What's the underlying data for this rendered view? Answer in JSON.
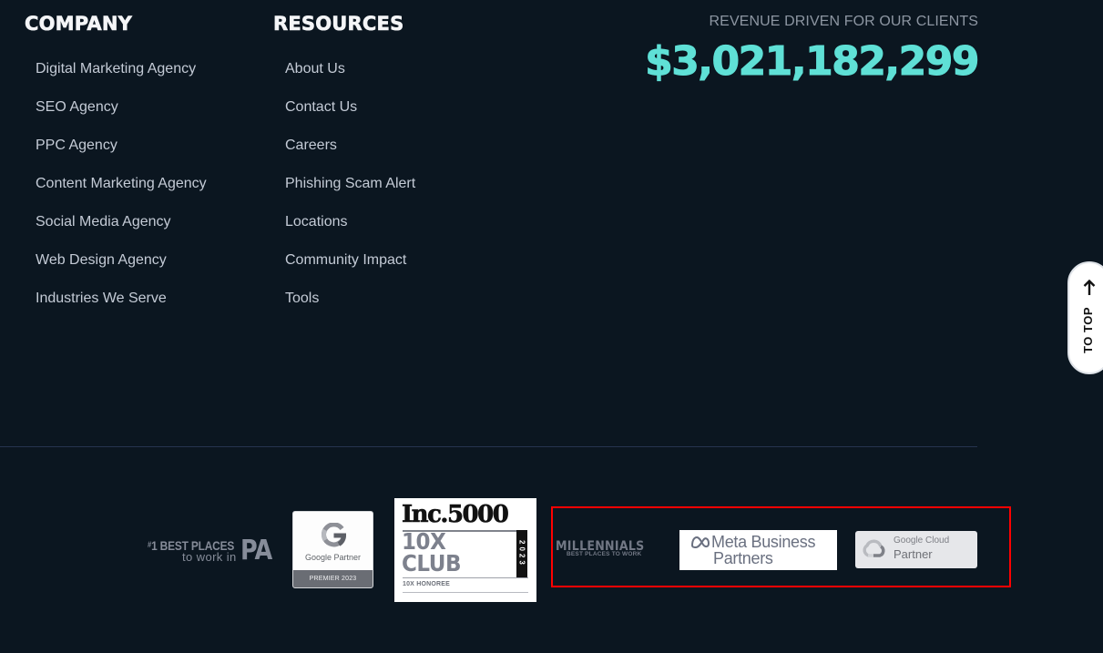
{
  "company": {
    "heading": "COMPANY",
    "links": [
      "Digital Marketing Agency",
      "SEO Agency",
      "PPC Agency",
      "Content Marketing Agency",
      "Social Media Agency",
      "Web Design Agency",
      "Industries We Serve"
    ]
  },
  "resources": {
    "heading": "RESOURCES",
    "links": [
      "About Us",
      "Contact Us",
      "Careers",
      "Phishing Scam Alert",
      "Locations",
      "Community Impact",
      "Tools"
    ]
  },
  "revenue": {
    "label": "REVENUE DRIVEN FOR OUR CLIENTS",
    "value": "$3,021,182,299",
    "color": "#5fe0d6"
  },
  "to_top": {
    "label": "TO TOP",
    "icon": "arrow-up-icon"
  },
  "badges": {
    "best_places_pa": {
      "hash": "#",
      "top": "1 BEST PLACES",
      "bottom": "to work in",
      "state": "PA"
    },
    "google_partner": {
      "name": "Google Partner",
      "footer": "PREMIER 2023"
    },
    "inc5000": {
      "title": "Inc.5000",
      "club_line1": "10X",
      "club_line2": "CLUB",
      "year": "2023",
      "honoree": "10X HONOREE"
    },
    "millennials": {
      "title": "MILLENNIALS",
      "subtitle": "BEST PLACES TO WORK"
    },
    "meta": {
      "line1": "Meta Business",
      "line2": "Partners"
    },
    "google_cloud": {
      "line1": "Google Cloud",
      "line2": "Partner"
    }
  },
  "annotation": {
    "color": "#ff0000"
  }
}
